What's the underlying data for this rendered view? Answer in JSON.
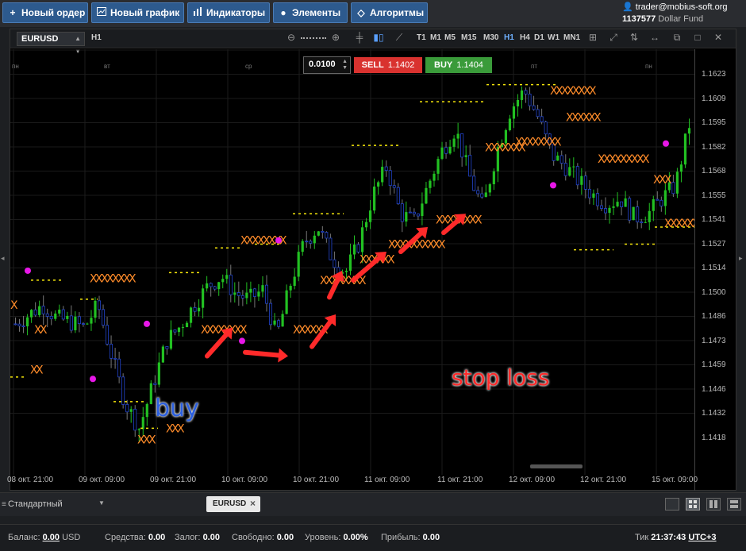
{
  "toolbar": {
    "new_order": "Новый ордер",
    "new_chart": "Новый график",
    "indicators": "Индикаторы",
    "elements": "Элементы",
    "algorithms": "Алгоритмы"
  },
  "account": {
    "user": "trader@mobius-soft.org",
    "number": "1137577",
    "fund": "Dollar Fund"
  },
  "chart": {
    "symbol": "EURUSD",
    "period": "H1",
    "timeframes": [
      "T1",
      "M1",
      "M5",
      "M15",
      "M30",
      "H1",
      "H4",
      "D1",
      "W1",
      "MN1"
    ],
    "active_timeframe": "H1",
    "lot": "0.0100",
    "sell_label": "SELL",
    "sell_price": "1.1402",
    "buy_label": "BUY",
    "buy_price": "1.1404",
    "days": [
      "пн",
      "вт",
      "ср",
      "пт",
      "пн"
    ],
    "x_labels": [
      "08 окт. 21:00",
      "09 окт. 09:00",
      "09 окт. 21:00",
      "10 окт. 09:00",
      "10 окт. 21:00",
      "11 окт. 09:00",
      "11 окт. 21:00",
      "12 окт. 09:00",
      "12 окт. 21:00",
      "15 окт. 09:00"
    ],
    "y_labels": [
      "1.1623",
      "1.1609",
      "1.1595",
      "1.1582",
      "1.1568",
      "1.1555",
      "1.1541",
      "1.1527",
      "1.1514",
      "1.1500",
      "1.1486",
      "1.1473",
      "1.1459",
      "1.1446",
      "1.1432",
      "1.1418"
    ],
    "annotation_buy": "buy",
    "annotation_stop": "stop loss",
    "colors": {
      "bull": "#22c022",
      "bear": "#9a9a9a",
      "stop_marker": "#ff8c2a",
      "level_line": "#f5e60a",
      "dot": "#e817e8",
      "arrow": "#ff2a2a"
    }
  },
  "tabs": {
    "layout_name": "Стандартный",
    "open_tab": "EURUSD"
  },
  "status": {
    "balance_label": "Баланс:",
    "balance_value": "0.00",
    "balance_currency": "USD",
    "funds_label": "Средства:",
    "funds_value": "0.00",
    "margin_label": "Залог:",
    "margin_value": "0.00",
    "free_label": "Свободно:",
    "free_value": "0.00",
    "level_label": "Уровень:",
    "level_value": "0.00%",
    "profit_label": "Прибыль:",
    "profit_value": "0.00",
    "tick_label": "Тик",
    "tick_time": "21:37:43",
    "timezone": "UTC+3"
  },
  "chart_data": {
    "type": "candlestick",
    "symbol": "EURUSD",
    "timeframe": "H1",
    "ylim": [
      1.141,
      1.163
    ],
    "series": [
      {
        "name": "price",
        "values": [
          1.1487,
          1.1492,
          1.1497,
          1.149,
          1.1488,
          1.1485,
          1.1497,
          1.147,
          1.1445,
          1.1432,
          1.1455,
          1.1478,
          1.1486,
          1.1497,
          1.1507,
          1.1512,
          1.1503,
          1.15,
          1.1505,
          1.148,
          1.1508,
          1.153,
          1.1538,
          1.1522,
          1.1514,
          1.153,
          1.1555,
          1.157,
          1.1545,
          1.1541,
          1.156,
          1.1578,
          1.159,
          1.1565,
          1.1548,
          1.1578,
          1.16,
          1.161,
          1.1596,
          1.1576,
          1.157,
          1.1562,
          1.1555,
          1.155,
          1.1553,
          1.1543,
          1.1545,
          1.1553,
          1.156,
          1.1592
        ]
      }
    ]
  }
}
